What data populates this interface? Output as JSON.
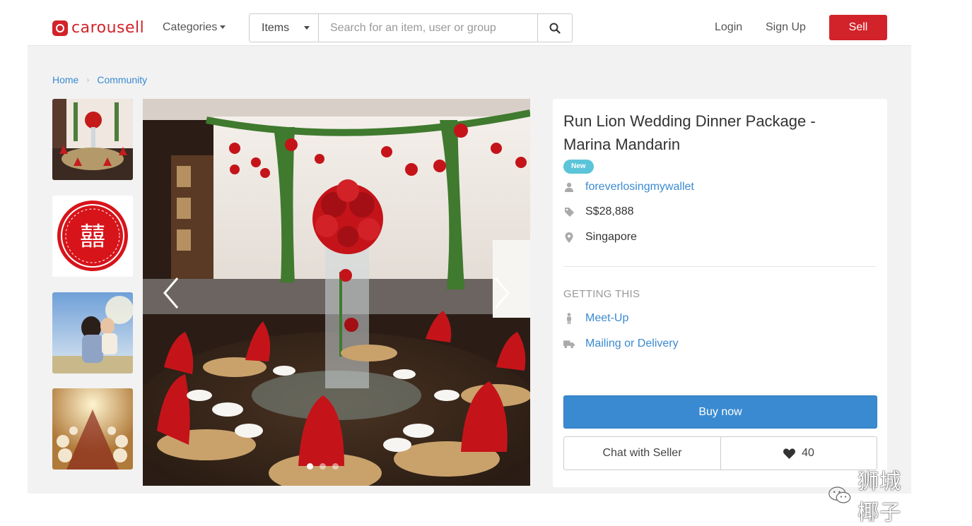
{
  "header": {
    "logo_text": "carousell",
    "categories_label": "Categories",
    "search_category": "Items",
    "search_placeholder": "Search for an item, user or group",
    "login_label": "Login",
    "signup_label": "Sign Up",
    "sell_label": "Sell",
    "brand_color": "#d2232a"
  },
  "breadcrumb": {
    "items": [
      "Home",
      "Community"
    ]
  },
  "gallery": {
    "thumbnail_icons": [
      "wedding-venue-thumbnail",
      "double-happiness-thumbnail",
      "couple-thumbnail",
      "banquet-hall-thumbnail"
    ],
    "prev_icon": "chevron-left-icon",
    "next_icon": "chevron-right-icon",
    "slide_count": 3,
    "active_slide": 1
  },
  "listing": {
    "title": "Run Lion Wedding Dinner Package - Marina Mandarin",
    "badge": "New",
    "seller": "foreverlosingmywallet",
    "price": "S$28,888",
    "location": "Singapore",
    "getting_this_heading": "GETTING THIS",
    "delivery_options": [
      "Meet-Up",
      "Mailing or Delivery"
    ],
    "buy_label": "Buy now",
    "chat_label": "Chat with Seller",
    "likes": "40",
    "accent_color": "#3a8ad1",
    "badge_color": "#5bc4d8"
  },
  "watermark": {
    "text": "狮城椰子",
    "icon": "wechat-icon"
  }
}
